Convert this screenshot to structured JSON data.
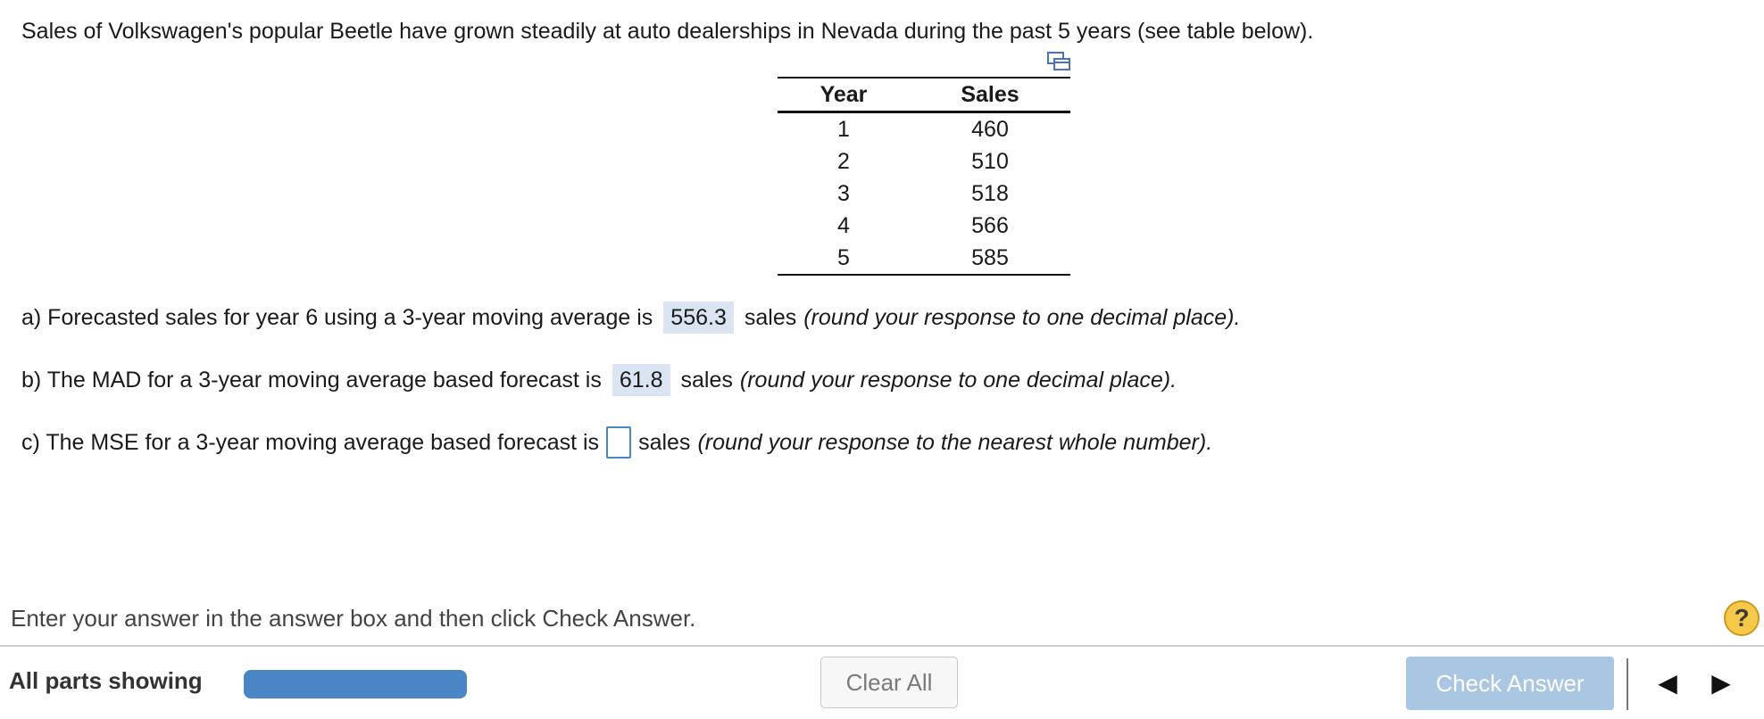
{
  "question": {
    "intro": "Sales of Volkswagen's popular Beetle have grown steadily at auto dealerships in Nevada during the past 5 years (see table below)."
  },
  "table": {
    "headers": [
      "Year",
      "Sales"
    ],
    "rows": [
      [
        "1",
        "460"
      ],
      [
        "2",
        "510"
      ],
      [
        "3",
        "518"
      ],
      [
        "4",
        "566"
      ],
      [
        "5",
        "585"
      ]
    ]
  },
  "parts": {
    "a": {
      "prefix": "a) Forecasted sales for year 6 using a 3-year moving average is",
      "answer": "556.3",
      "suffix": "sales",
      "note": "(round your response to one decimal place)."
    },
    "b": {
      "prefix": "b) The MAD for a 3-year moving average based forecast is",
      "answer": "61.8",
      "suffix": "sales",
      "note": "(round your response to one decimal place)."
    },
    "c": {
      "prefix": "c) The MSE for a 3-year moving average based forecast is",
      "answer": "",
      "suffix": "sales",
      "note": "(round your response to the nearest whole number)."
    }
  },
  "footer": {
    "instructions": "Enter your answer in the answer box and then click Check Answer.",
    "help_label": "?",
    "parts_label": "All parts showing",
    "progress": 1.0,
    "clear_all": "Clear All",
    "check_answer": "Check Answer",
    "prev_icon": "◀",
    "next_icon": "▶"
  },
  "colors": {
    "accent": "#4a86c5",
    "answer_bg": "#dae4f2",
    "check_bg": "#a9c6e3",
    "help_bg": "#f6c94a"
  }
}
